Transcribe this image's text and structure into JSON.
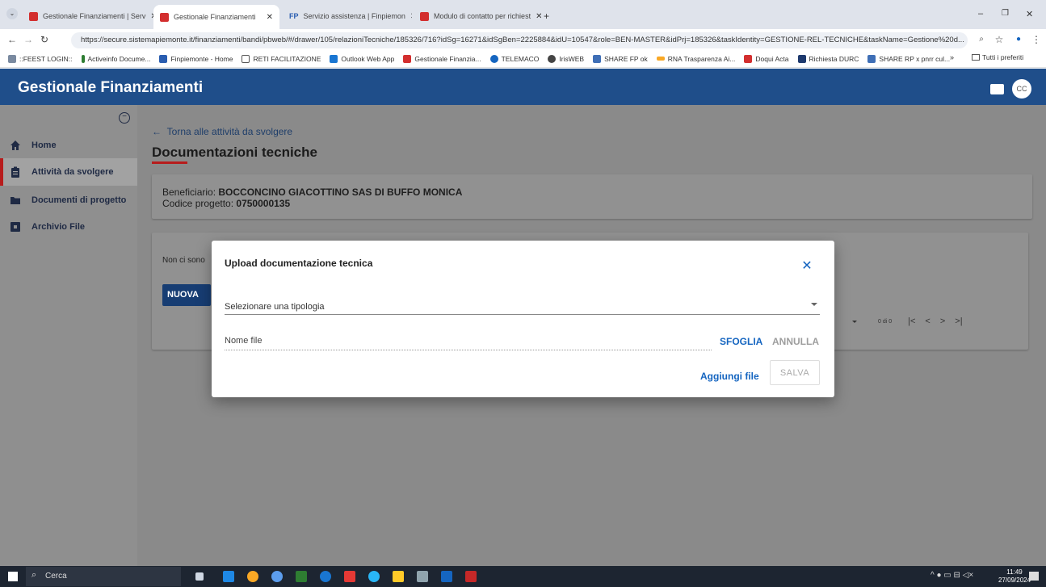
{
  "browser": {
    "tabs": [
      {
        "label": "Gestionale Finanziamenti | Serv",
        "active": false
      },
      {
        "label": "Gestionale Finanziamenti",
        "active": true
      },
      {
        "label": "Servizio assistenza | Finpiemon",
        "active": false
      },
      {
        "label": "Modulo di contatto per richiest",
        "active": false
      }
    ],
    "url": "https://secure.sistemapiemonte.it/finanziamenti/bandi/pbweb/#/drawer/105/relazioniTecniche/185326/716?idSg=16271&idSgBen=2225884&idU=10547&role=BEN-MASTER&idPrj=185326&taskIdentity=GESTIONE-REL-TECNICHE&taskName=Gestione%20d...",
    "bookmarks": [
      "::FEEST LOGIN::",
      "Activeinfo Docume...",
      "Finpiemonte - Home",
      "RETI FACILITAZIONE",
      "Outlook Web App",
      "Gestionale Finanzia...",
      "TELEMACO",
      "IrisWEB",
      "SHARE FP ok",
      "RNA Trasparenza Ai...",
      "Doqui Acta",
      "Richiesta DURC",
      "SHARE RP x pnrr cul..."
    ],
    "bookmarks_more": "»",
    "all_bookmarks": "Tutti i preferiti"
  },
  "app": {
    "title": "Gestionale Finanziamenti",
    "avatar": "CC"
  },
  "sidebar": {
    "items": [
      {
        "label": "Home",
        "icon": "home-icon"
      },
      {
        "label": "Attività da svolgere",
        "icon": "clipboard-icon"
      },
      {
        "label": "Documenti di progetto",
        "icon": "folder-icon"
      },
      {
        "label": "Archivio File",
        "icon": "archive-icon"
      }
    ]
  },
  "main": {
    "back_link": "Torna alle attività da svolgere",
    "page_title": "Documentazioni tecniche",
    "beneficiary_label": "Beneficiario:",
    "beneficiary_value": "BOCCONCINO GIACOTTINO SAS DI BUFFO MONICA",
    "project_code_label": "Codice progetto:",
    "project_code_value": "0750000135",
    "empty_text": "Non ci sono",
    "new_button": "NUOVA",
    "pager_range": "0 di 0"
  },
  "modal": {
    "title": "Upload documentazione tecnica",
    "select_placeholder": "Selezionare una tipologia",
    "file_placeholder": "Nome file",
    "browse": "SFOGLIA",
    "cancel": "ANNULLA",
    "add_file": "Aggiungi file",
    "save": "SALVA"
  },
  "taskbar": {
    "search": "Cerca",
    "time": "11:49",
    "date": "27/09/2024"
  }
}
